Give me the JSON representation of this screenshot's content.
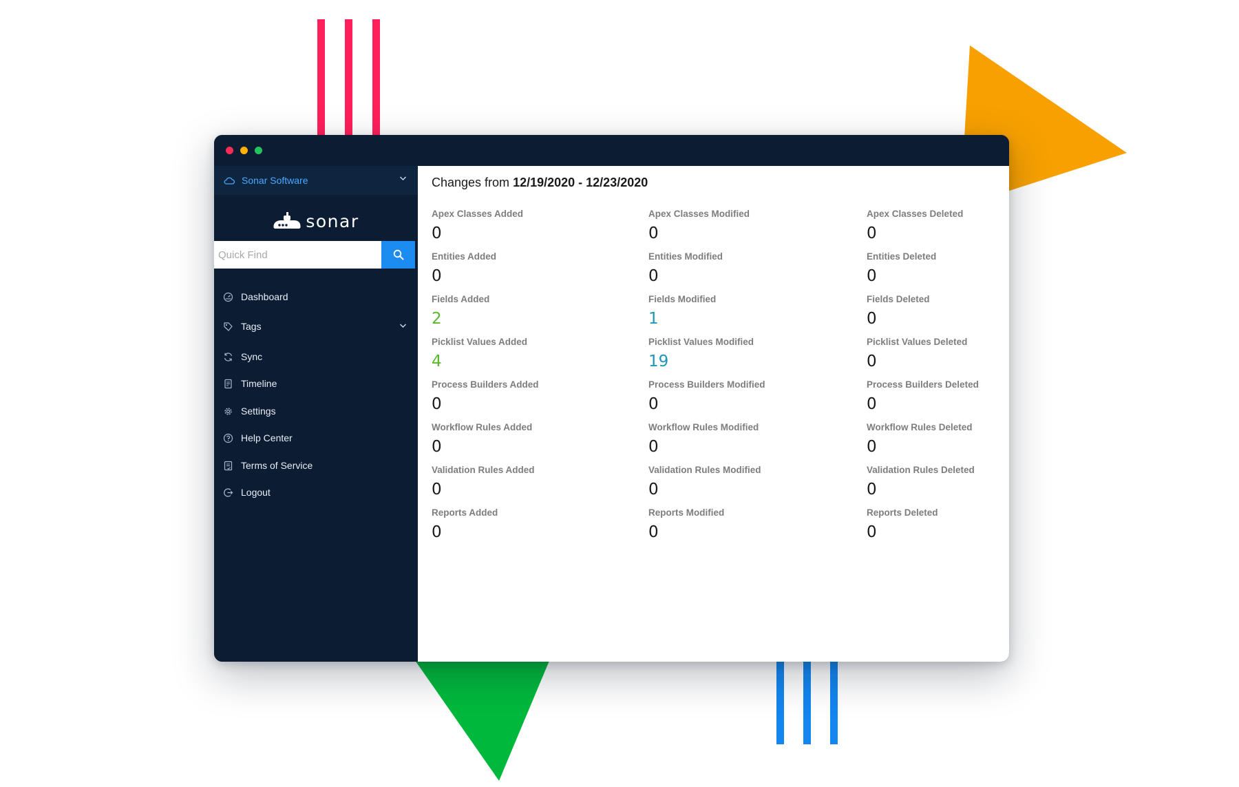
{
  "colors": {
    "window_bg": "#0b1c33",
    "accent_blue": "#1d8cf0",
    "link_blue": "#4aa8ff",
    "deco_red": "#ff1f5a",
    "deco_orange": "#f7a000",
    "deco_green": "#00b93c",
    "deco_blue": "#1386f0",
    "value_green": "#5ab82a",
    "value_teal": "#1d97b3"
  },
  "sidebar": {
    "org_name": "Sonar Software",
    "org_icon": "cloud-icon",
    "logo_text": "sonar",
    "search": {
      "placeholder": "Quick Find",
      "value": "",
      "icon": "search-icon"
    },
    "items": [
      {
        "label": "Dashboard",
        "icon": "dashboard-icon"
      },
      {
        "label": "Tags",
        "icon": "tag-icon",
        "expandable": true
      },
      {
        "label": "Sync",
        "icon": "sync-icon"
      },
      {
        "label": "Timeline",
        "icon": "timeline-icon"
      },
      {
        "label": "Settings",
        "icon": "gear-icon"
      },
      {
        "label": "Help Center",
        "icon": "help-icon"
      },
      {
        "label": "Terms of Service",
        "icon": "document-icon"
      },
      {
        "label": "Logout",
        "icon": "logout-icon"
      }
    ]
  },
  "main": {
    "title_prefix": "Changes from",
    "title_range": "12/19/2020 - 12/23/2020",
    "stats": [
      {
        "label": "Apex Classes Added",
        "value": "0"
      },
      {
        "label": "Apex Classes Modified",
        "value": "0"
      },
      {
        "label": "Apex Classes Deleted",
        "value": "0"
      },
      {
        "label": "Entities Added",
        "value": "0"
      },
      {
        "label": "Entities Modified",
        "value": "0"
      },
      {
        "label": "Entities Deleted",
        "value": "0"
      },
      {
        "label": "Fields Added",
        "value": "2",
        "tone": "green"
      },
      {
        "label": "Fields Modified",
        "value": "1",
        "tone": "teal"
      },
      {
        "label": "Fields Deleted",
        "value": "0"
      },
      {
        "label": "Picklist Values Added",
        "value": "4",
        "tone": "green"
      },
      {
        "label": "Picklist Values Modified",
        "value": "19",
        "tone": "teal"
      },
      {
        "label": "Picklist Values Deleted",
        "value": "0"
      },
      {
        "label": "Process Builders Added",
        "value": "0"
      },
      {
        "label": "Process Builders Modified",
        "value": "0"
      },
      {
        "label": "Process Builders Deleted",
        "value": "0"
      },
      {
        "label": "Workflow Rules Added",
        "value": "0"
      },
      {
        "label": "Workflow Rules Modified",
        "value": "0"
      },
      {
        "label": "Workflow Rules Deleted",
        "value": "0"
      },
      {
        "label": "Validation Rules Added",
        "value": "0"
      },
      {
        "label": "Validation Rules Modified",
        "value": "0"
      },
      {
        "label": "Validation Rules Deleted",
        "value": "0"
      },
      {
        "label": "Reports Added",
        "value": "0"
      },
      {
        "label": "Reports Modified",
        "value": "0"
      },
      {
        "label": "Reports Deleted",
        "value": "0"
      }
    ]
  }
}
